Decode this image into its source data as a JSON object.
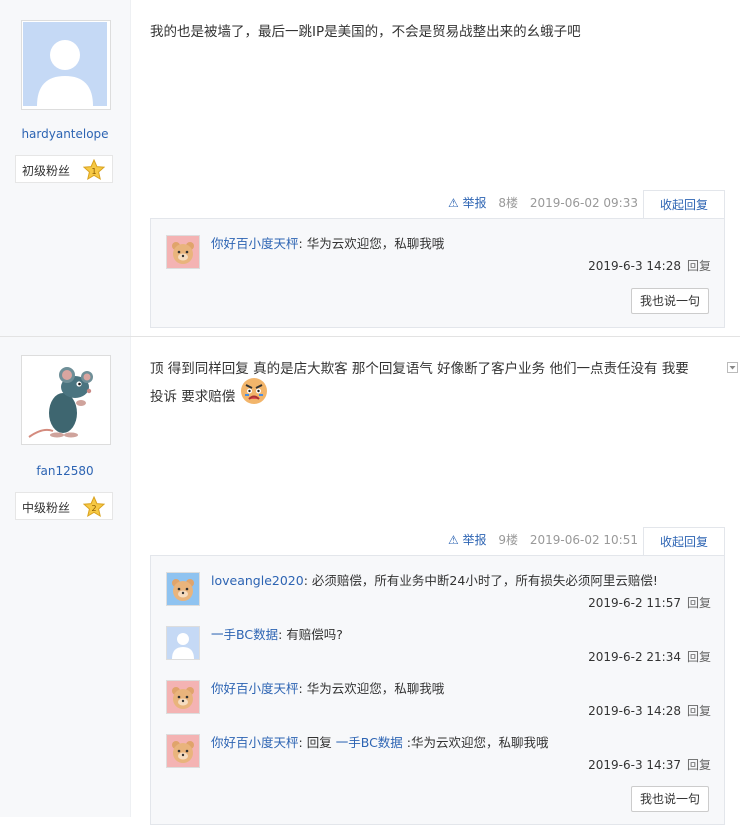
{
  "posts": [
    {
      "username": "hardyantelope",
      "level_label": "初级粉丝",
      "level_num": "1",
      "content": "我的也是被墙了，最后一跳IP是美国的，不会是贸易战整出来的幺蛾子吧",
      "report_label": "举报",
      "floor": "8楼",
      "datetime": "2019-06-02 09:33",
      "collapse_label": "收起回复",
      "replies": [
        {
          "name": "你好百小度天枰",
          "sep": ":",
          "text": "华为云欢迎您，私聊我哦",
          "time": "2019-6-3 14:28",
          "reply_label": "回复"
        }
      ],
      "say_button": "我也说一句"
    },
    {
      "username": "fan12580",
      "level_label": "中级粉丝",
      "level_num": "2",
      "content_line1": "顶 得到同样回复 真的是店大欺客 那个回复语气 好像断了客户业务 他们一点责任没有 我要",
      "content_line2": "投诉 要求赔偿",
      "report_label": "举报",
      "floor": "9楼",
      "datetime": "2019-06-02 10:51",
      "collapse_label": "收起回复",
      "replies": [
        {
          "name": "loveangle2020",
          "sep": ":",
          "text": "必须赔偿，所有业务中断24小时了，所有损失必须阿里云赔偿!",
          "time": "2019-6-2 11:57",
          "reply_label": "回复"
        },
        {
          "name": "一手BC数据",
          "sep": ":",
          "text": "有赔偿吗?",
          "time": "2019-6-2 21:34",
          "reply_label": "回复"
        },
        {
          "name": "你好百小度天枰",
          "sep": ":",
          "text": "华为云欢迎您，私聊我哦",
          "time": "2019-6-3 14:28",
          "reply_label": "回复"
        },
        {
          "name": "你好百小度天枰",
          "sep": ":",
          "pre": "回复",
          "mention": "一手BC数据",
          "text": ":华为云欢迎您，私聊我哦",
          "time": "2019-6-3 14:37",
          "reply_label": "回复"
        }
      ],
      "say_button": "我也说一句"
    }
  ],
  "colors": {
    "link": "#2d64b3",
    "sidebar": "#f7f8fa",
    "star": "#f7c944"
  },
  "icons": {
    "report": "warning-triangle-icon",
    "level": "star-badge-icon"
  }
}
